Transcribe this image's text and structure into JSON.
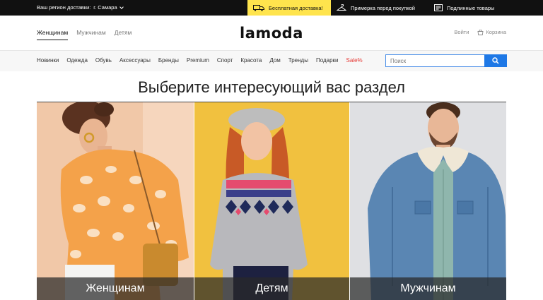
{
  "topbar": {
    "region_label": "Ваш регион доставки:",
    "city": "г. Самара",
    "promos": [
      {
        "icon": "truck-icon",
        "label": "Бесплатная доставка!"
      },
      {
        "icon": "hanger-icon",
        "label": "Примерка перед покупкой"
      },
      {
        "icon": "certificate-icon",
        "label": "Подлинные товары"
      }
    ]
  },
  "header": {
    "gender_tabs": [
      "Женщинам",
      "Мужчинам",
      "Детям"
    ],
    "active_tab": "Женщинам",
    "logo": "lamoda",
    "login": "Войти",
    "cart": "Корзина"
  },
  "nav": {
    "items": [
      "Новинки",
      "Одежда",
      "Обувь",
      "Аксессуары",
      "Бренды",
      "Premium",
      "Спорт",
      "Красота",
      "Дом",
      "Тренды",
      "Подарки",
      "Sale%"
    ],
    "search_placeholder": "Поиск"
  },
  "main": {
    "title": "Выберите интересующий вас раздел",
    "categories": [
      {
        "label": "Женщинам"
      },
      {
        "label": "Детям"
      },
      {
        "label": "Мужчинам"
      }
    ]
  },
  "colors": {
    "accent_yellow": "#ffe44d",
    "search_blue": "#1e78e6",
    "sale_red": "#e53935"
  }
}
